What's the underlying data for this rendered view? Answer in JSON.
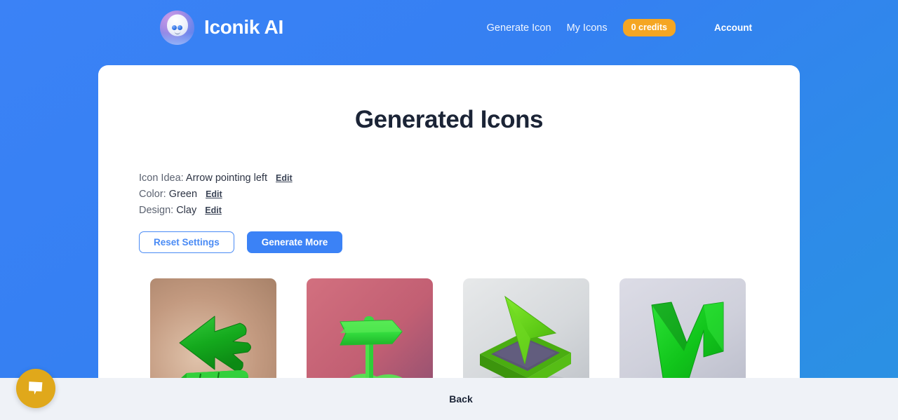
{
  "header": {
    "brand_name": "Iconik AI",
    "logo_icon": "robot-avatar-icon",
    "nav": {
      "generate_icon": "Generate Icon",
      "my_icons": "My Icons",
      "credits_badge": "0 credits",
      "account": "Account"
    }
  },
  "main": {
    "title": "Generated Icons",
    "settings": [
      {
        "label": "Icon Idea:",
        "value": "Arrow pointing left",
        "edit": "Edit"
      },
      {
        "label": "Color:",
        "value": "Green",
        "edit": "Edit"
      },
      {
        "label": "Design:",
        "value": "Clay",
        "edit": "Edit"
      }
    ],
    "reset_label": "Reset Settings",
    "generate_label": "Generate More",
    "icons": [
      {
        "name": "clay-arrow-left-on-tan",
        "description": "Green clay arrow pointing left standing on a base",
        "background": "#b5907a",
        "icon_color": "#1faa2a"
      },
      {
        "name": "clay-signpost-arrow-on-pink",
        "description": "Green clay signpost arrow pointing right on a hill",
        "background": "#cf6b7e",
        "icon_color": "#3fd94a"
      },
      {
        "name": "clay-cursor-arrow-on-gray",
        "description": "Green clay cursor arrow over a purple rounded square",
        "background": "#dcdfe2",
        "icon_color": "#62c81e"
      },
      {
        "name": "clay-v-arrow-on-lavender",
        "description": "Green clay V-shaped arrow pointing up-right",
        "background": "#d3d3dd",
        "icon_color": "#16c21f"
      }
    ]
  },
  "footer": {
    "back_label": "Back"
  },
  "chat": {
    "icon": "chat-bubble-icon"
  },
  "colors": {
    "page_background": "#3b82f6",
    "accent": "#3b82f6",
    "badge": "#f5a623",
    "footer_background": "#eff2f7",
    "chat_button": "#e0a81b",
    "title": "#1b2436"
  }
}
